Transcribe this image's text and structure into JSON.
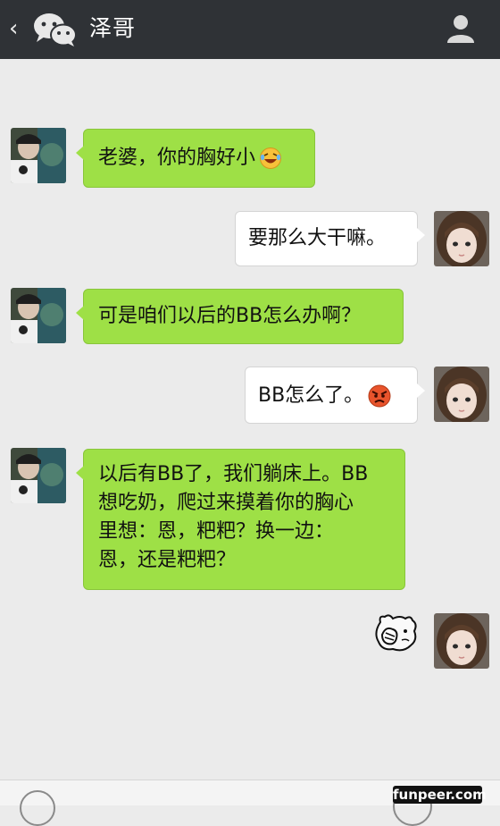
{
  "header": {
    "back_icon": "chevron-left-icon",
    "logo_icon": "wechat-logo-icon",
    "title": "泽哥",
    "profile_icon": "person-icon"
  },
  "messages": [
    {
      "side": "left",
      "text": "老婆，你的胸好小",
      "emoji": "laughing-tears-emoji"
    },
    {
      "side": "right",
      "text": "要那么大干嘛。"
    },
    {
      "side": "left",
      "text": "可是咱们以后的BB怎么办啊？"
    },
    {
      "side": "right",
      "text": "BB怎么了。",
      "emoji": "angry-face-emoji"
    },
    {
      "side": "left",
      "lines": [
        "以后有BB了，我们躺床上。BB",
        "想吃奶，爬过来摸着你的胸心",
        "里想：恩，粑粑？换一边：",
        "恩，还是粑粑？"
      ]
    },
    {
      "side": "right",
      "sticker": "facepalm-bear-sticker"
    }
  ],
  "watermark": "funpeer.com",
  "colors": {
    "header_bg": "#2f3236",
    "chat_bg": "#ebebeb",
    "sent_bubble": "#9ee046",
    "received_bubble": "#ffffff"
  }
}
